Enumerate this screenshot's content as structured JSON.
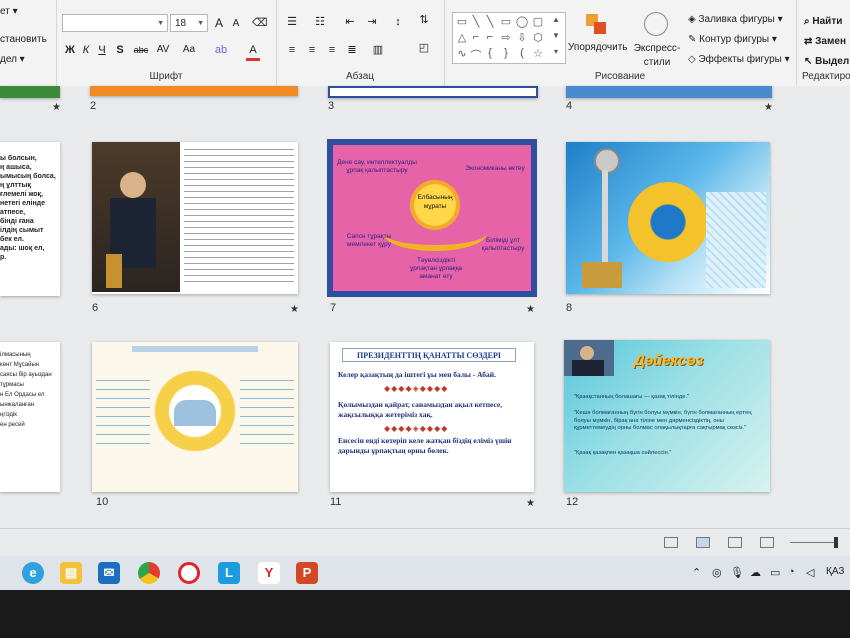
{
  "ribbon": {
    "clipboard_partial": [
      "ет ▾",
      "становить",
      "дел ▾"
    ],
    "font": {
      "name_value": "",
      "size_value": "18",
      "grow_label": "A",
      "shrink_label": "A",
      "bold": "Ж",
      "italic": "К",
      "underline": "Ч",
      "shadow": "S",
      "strike": "abc",
      "spacing": "AV",
      "case": "Aa",
      "color": "A",
      "group_label": "Шрифт"
    },
    "paragraph": {
      "group_label": "Абзац"
    },
    "drawing": {
      "arrange_label": "Упорядочить",
      "styles_label": "Экспресс-стили",
      "fill_label": "Заливка фигуры",
      "outline_label": "Контур фигуры",
      "effects_label": "Эффекты фигуры",
      "group_label": "Рисование"
    },
    "editing": {
      "find_label": "Найти",
      "replace_label": "Замен",
      "select_label": "Выдел",
      "group_label": "Редактиро"
    }
  },
  "slides": {
    "row1_numbers": [
      "2",
      "3",
      "4"
    ],
    "row2": {
      "left_partial_lines": [
        "ы болсын,",
        "ң ашыса,",
        "ымысың болса,",
        "ң ұлттық",
        "ғлемелі жоқ,",
        "нетегі елінде",
        "атпесе,",
        "бінді ғана",
        "ілдің сымыт",
        "бек ел.",
        "ады: шоқ ел,",
        "р."
      ],
      "numbers": [
        "6",
        "7",
        "8"
      ],
      "slide7": {
        "top_left": "Дене сау, интеллектуалды ұрпақ қалыптастыру",
        "top_right": "Экономиканы өктеу",
        "center": "Елбасының мұраты",
        "left": "Сапсн тұрақты мемлекет құру",
        "right": "Біліміді ұлт қалыптастыру",
        "bottom": "Тәуелсіздікті ұрпақтан ұрпаққа аманат ету"
      }
    },
    "row3": {
      "left_partial_lines": [
        "ілмасының",
        "кент Мұсайын",
        "саясы бір ауыздан",
        "тұрмасы",
        "н Ел Ордасы ел",
        "ынжаланған",
        "ңгіздік",
        "ен ресей"
      ],
      "numbers": [
        "10",
        "11",
        "12"
      ],
      "slide11": {
        "title": "ПРЕЗИДЕНТТІҢ ҚАНАТТЫ СӨЗДЕРІ",
        "p1": "Келер қазақтың да іштегі ұы мен балы - Абай.",
        "p2": "Қолымыздан қайрат, санамыздан ақыл кетпесе, жақсылыққа жетеріміз хақ.",
        "p3": "Енсесін енді көтеріп келе жатқан біздің еліміз үшін дарынды ұрпақтың орны бөлек.",
        "ornament": "◆◆◆◆◈◆◆◆◆"
      },
      "slide12": {
        "title": "Дәйексөз",
        "q1": "\"Қазақстанның болашағы — қазақ тілінде.\"",
        "q2": "\"Кешә болмағанның бүгін болуы мүмкін, бүгін болмағанның ертең болуы мүмкін, бірақ ана тіліне мен дәрменсіздіктің, оны құрметтемеудің орны болмас олақылықтарға сақтырмақ сөзсіз.\"",
        "q3": "\"Қазақ қазақпен қазақша сөйлессін.\""
      }
    }
  },
  "taskbar": {
    "lang": "ҚАЗ",
    "apps": [
      "edge",
      "file-explorer",
      "mail",
      "chrome",
      "opera",
      "l-app",
      "yandex",
      "powerpoint"
    ]
  }
}
